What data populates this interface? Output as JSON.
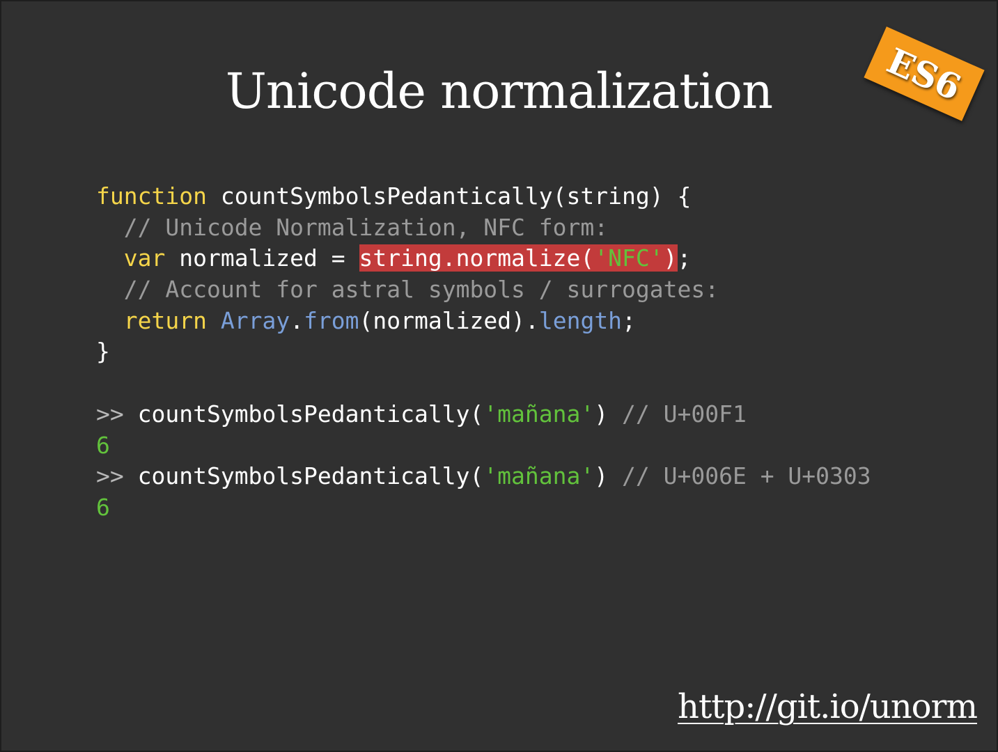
{
  "slide": {
    "title": "Unicode normalization",
    "badge": "ES6",
    "link": "http://git.io/unorm"
  },
  "code": {
    "l1_kw": "function",
    "l1_rest": " countSymbolsPedantically(string) {",
    "l2_comment": "// Unicode Normalization, NFC form:",
    "l3_kw": "var",
    "l3_mid": " normalized = ",
    "l3_hl_a": "string.normalize(",
    "l3_hl_str": "'NFC'",
    "l3_hl_b": ")",
    "l3_end": ";",
    "l4_comment": "// Account for astral symbols / surrogates:",
    "l5_kw": "return",
    "l5_array": "Array",
    "l5_dot1": ".",
    "l5_from": "from",
    "l5_args": "(normalized)",
    "l5_dot2": ".",
    "l5_length": "length",
    "l5_end": ";",
    "l6": "}"
  },
  "console": {
    "prompt": ">>",
    "call1_fn": " countSymbolsPedantically(",
    "call1_arg": "'mañana'",
    "call1_close": ") ",
    "call1_comment": "// U+00F1",
    "result1": "6",
    "call2_fn": " countSymbolsPedantically(",
    "call2_arg": "'mañana'",
    "call2_close": ") ",
    "call2_comment": "// U+006E + U+0303",
    "result2": "6"
  },
  "colors": {
    "background": "#303030",
    "keyword": "#f5d54a",
    "comment": "#9a9a9a",
    "builtin": "#7a9fd9",
    "string": "#62c23c",
    "highlight": "#c23b3b",
    "badge": "#f59a1b"
  }
}
